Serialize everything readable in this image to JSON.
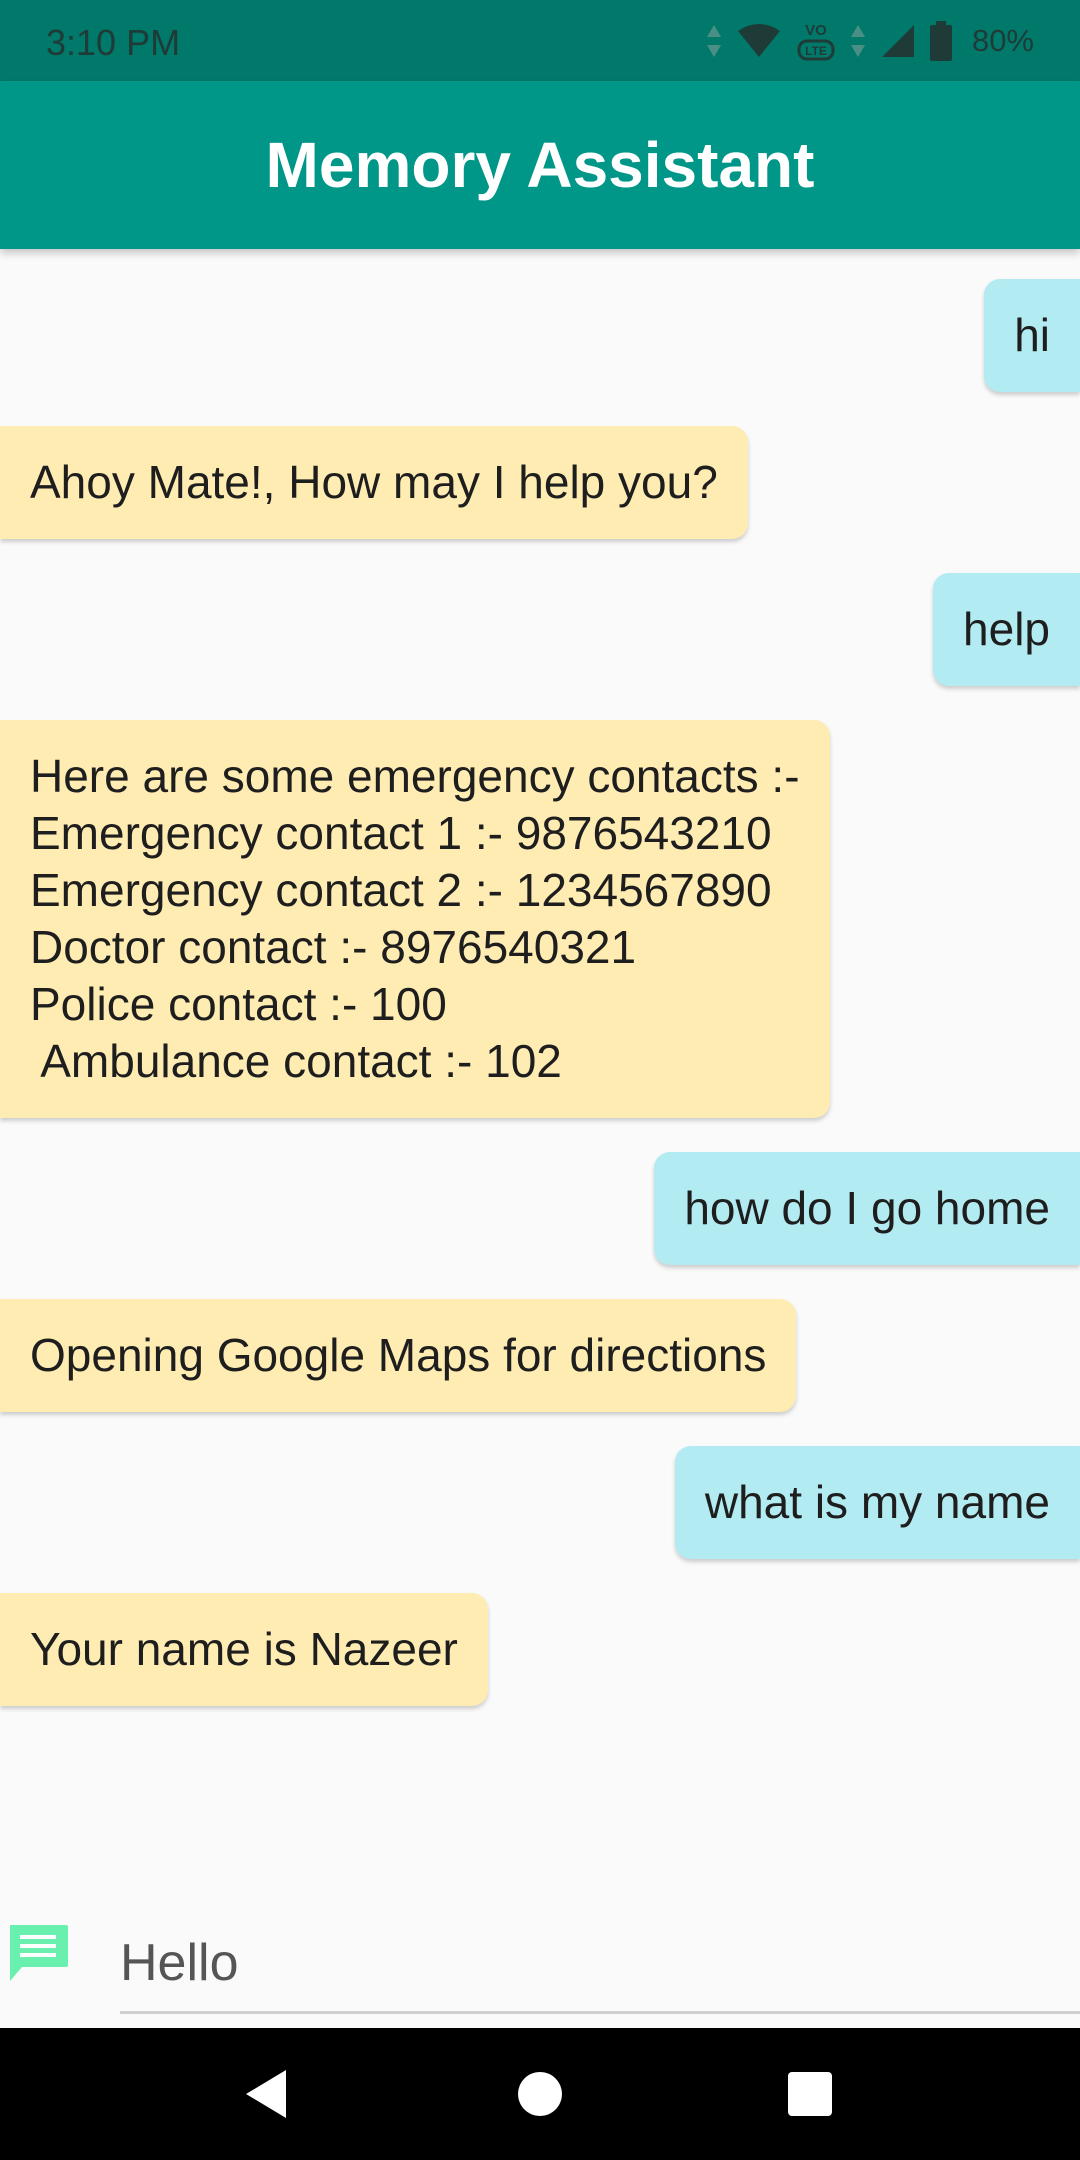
{
  "status": {
    "time": "3:10 PM",
    "battery": "80%",
    "icons": [
      "data-arrows-icon",
      "wifi-icon",
      "volte-icon",
      "data-arrows-icon",
      "signal-icon",
      "battery-icon"
    ]
  },
  "app_bar": {
    "title": "Memory Assistant"
  },
  "messages": [
    {
      "from": "user",
      "text": "hi"
    },
    {
      "from": "bot",
      "text": "Ahoy Mate!, How may I help you?"
    },
    {
      "from": "user",
      "text": "help"
    },
    {
      "from": "bot",
      "text": "Here are some emergency contacts :-\nEmergency contact 1 :- 9876543210\nEmergency contact 2 :- 1234567890\nDoctor contact :- 8976540321\nPolice contact :- 100\n Ambulance contact :- 102"
    },
    {
      "from": "user",
      "text": "how do I go home"
    },
    {
      "from": "bot",
      "text": "Opening Google Maps for directions"
    },
    {
      "from": "user",
      "text": "what is my name"
    },
    {
      "from": "bot",
      "text": "Your name is Nazeer"
    }
  ],
  "input": {
    "value": "Hello",
    "icon": "chat-message-icon"
  },
  "nav": {
    "icons": [
      "back-icon",
      "home-icon",
      "recents-icon"
    ]
  },
  "colors": {
    "status_bar": "#00796b",
    "app_bar": "#009688",
    "user_bubble": "#b3ebf2",
    "bot_bubble": "#ffecb3",
    "chat_icon": "#69f0ae"
  }
}
